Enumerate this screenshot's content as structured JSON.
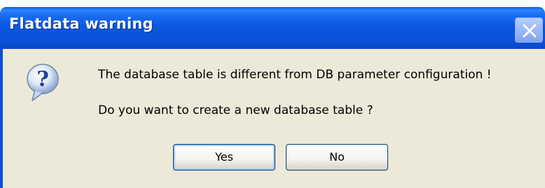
{
  "dialog": {
    "title": "Flatdata warning",
    "icon": "question-icon",
    "message_line1": "The database table is different from DB parameter configuration !",
    "message_line2": "Do you want to create a new database table ?",
    "buttons": {
      "yes_label": "Yes",
      "no_label": "No"
    },
    "colors": {
      "titlebar": "#0a51d8",
      "body": "#ece9d8",
      "title_text": "#ffffff"
    }
  }
}
